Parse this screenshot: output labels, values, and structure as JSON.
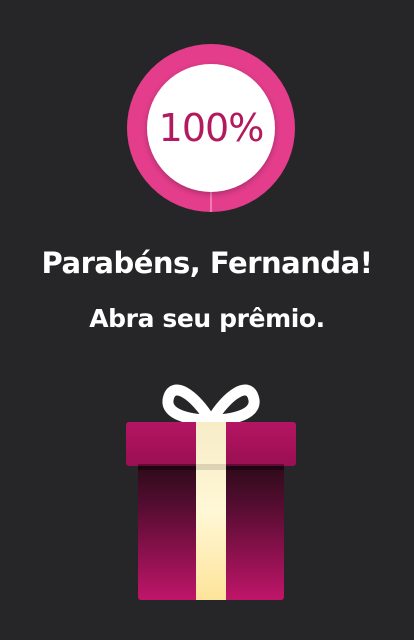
{
  "progress": {
    "label": "100%",
    "value": 100,
    "ring_color": "#e33d8c",
    "text_color": "#b3195e"
  },
  "greeting": {
    "title": "Parabéns, Fernanda!",
    "subtitle": "Abra seu prêmio."
  },
  "gift": {
    "icon": "gift-box-icon",
    "box_color": "#b0145e",
    "ribbon_color": "#fff4c4"
  }
}
